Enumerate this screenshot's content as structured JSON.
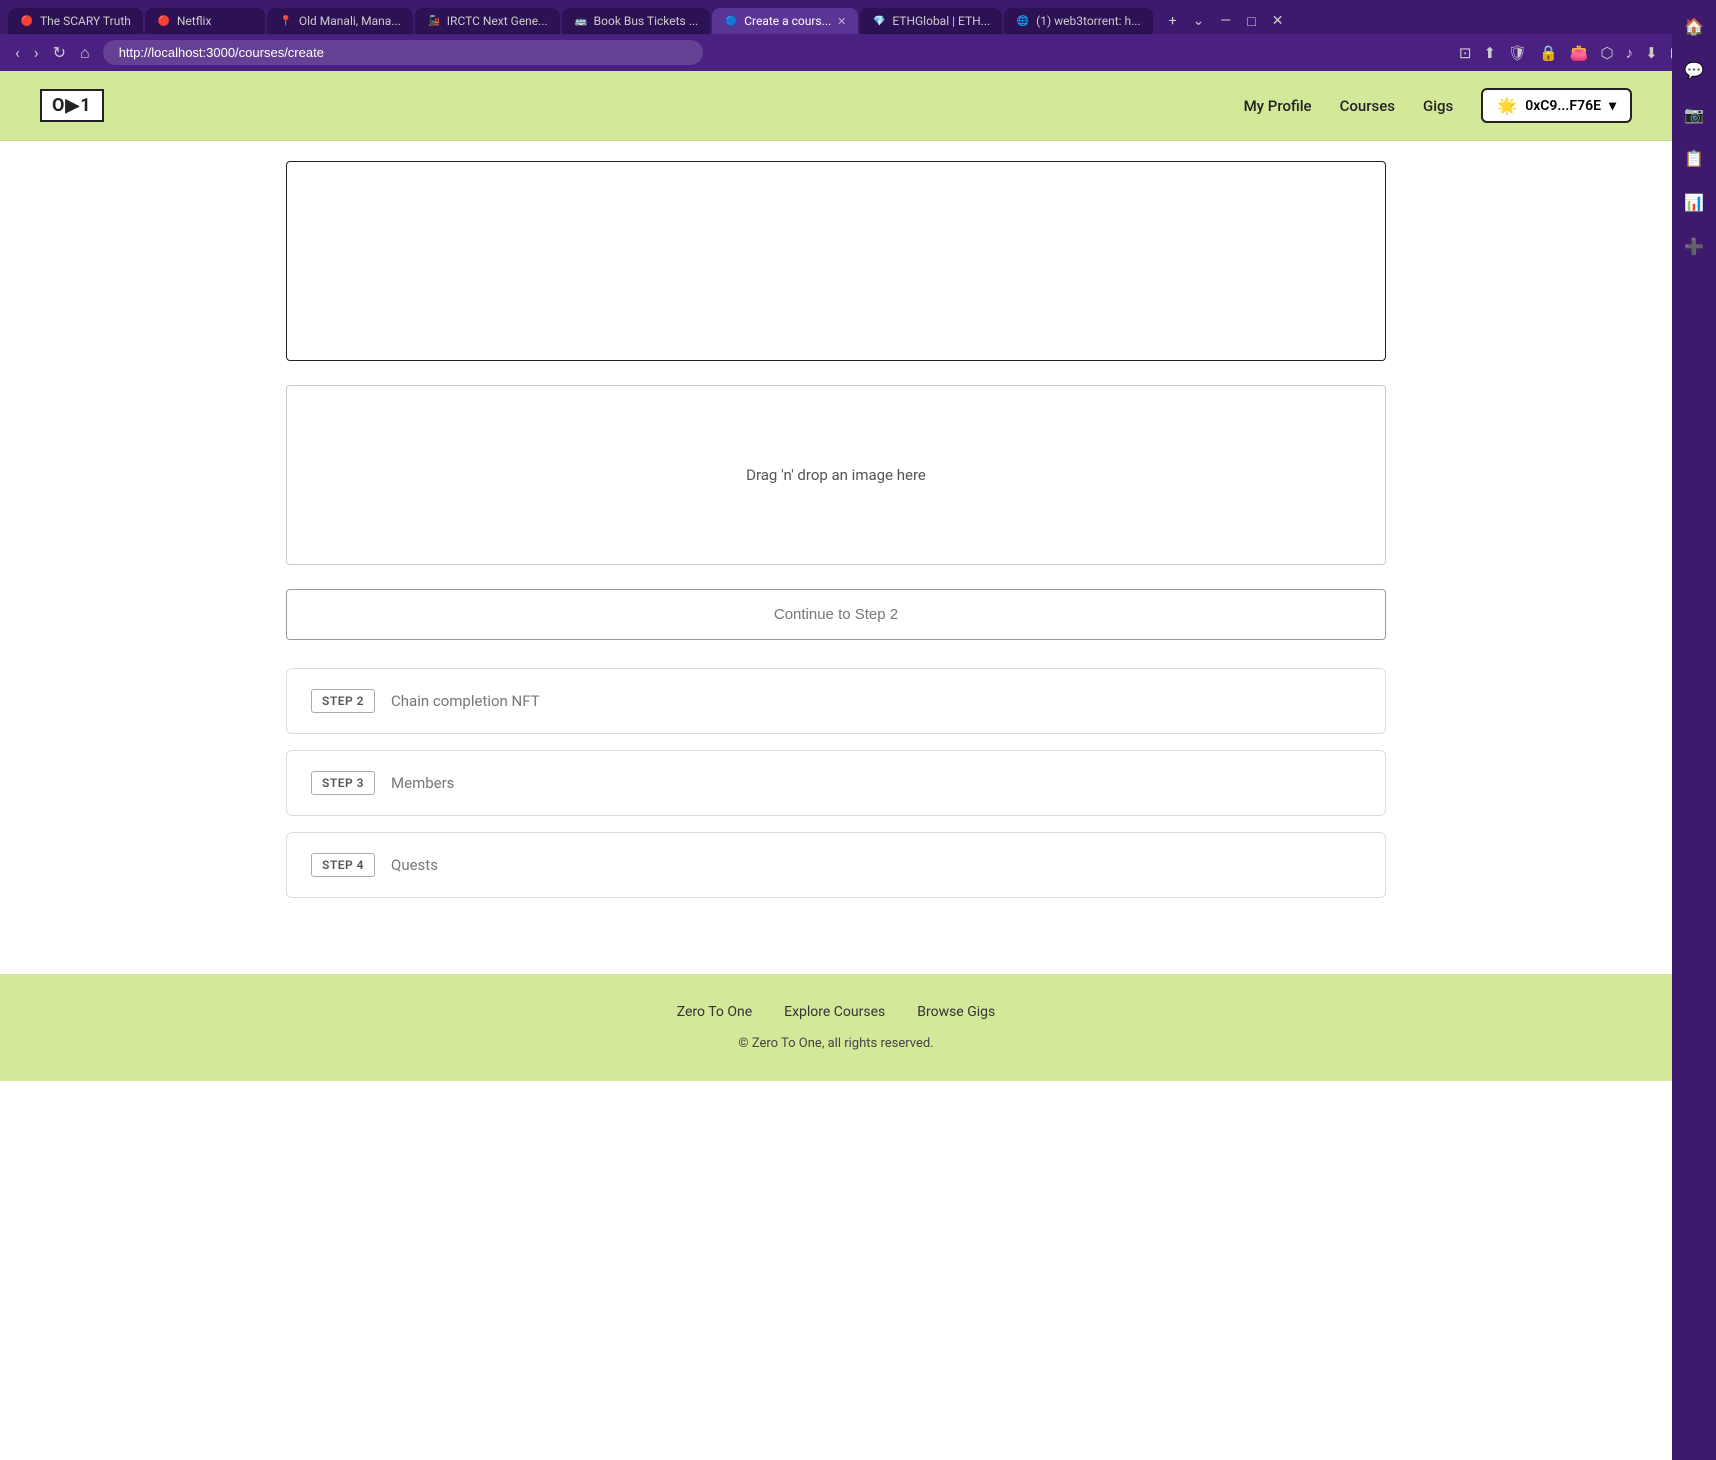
{
  "browser": {
    "url": "http://localhost:3000/courses/create",
    "tabs": [
      {
        "label": "The SCARY Truth",
        "favicon": "🔴",
        "active": false
      },
      {
        "label": "Netflix",
        "favicon": "🔴",
        "active": false
      },
      {
        "label": "Old Manali, Mana...",
        "favicon": "📍",
        "active": false
      },
      {
        "label": "IRCTC Next Gene...",
        "favicon": "🚂",
        "active": false
      },
      {
        "label": "Book Bus Tickets ...",
        "favicon": "🚌",
        "active": false
      },
      {
        "label": "Create a cours...",
        "favicon": "🔵",
        "active": true
      },
      {
        "label": "ETHGlobal | ETH...",
        "favicon": "💎",
        "active": false
      },
      {
        "label": "(1) web3torrent: h...",
        "favicon": "🌐",
        "active": false
      }
    ]
  },
  "navbar": {
    "logo": "O▶1",
    "my_profile": "My Profile",
    "courses": "Courses",
    "gigs": "Gigs",
    "wallet_address": "0xC9...F76E"
  },
  "page": {
    "image_drop_text": "Drag 'n' drop an image here",
    "continue_btn_label": "Continue to Step 2",
    "steps": [
      {
        "badge": "STEP 2",
        "label": "Chain completion NFT"
      },
      {
        "badge": "STEP 3",
        "label": "Members"
      },
      {
        "badge": "STEP 4",
        "label": "Quests"
      }
    ]
  },
  "footer": {
    "links": [
      {
        "label": "Zero To One"
      },
      {
        "label": "Explore Courses"
      },
      {
        "label": "Browse Gigs"
      }
    ],
    "copyright": "© Zero To One, all rights reserved."
  },
  "sidebar_icons": [
    "🏠",
    "💬",
    "📷",
    "📋",
    "📊",
    "➕"
  ]
}
